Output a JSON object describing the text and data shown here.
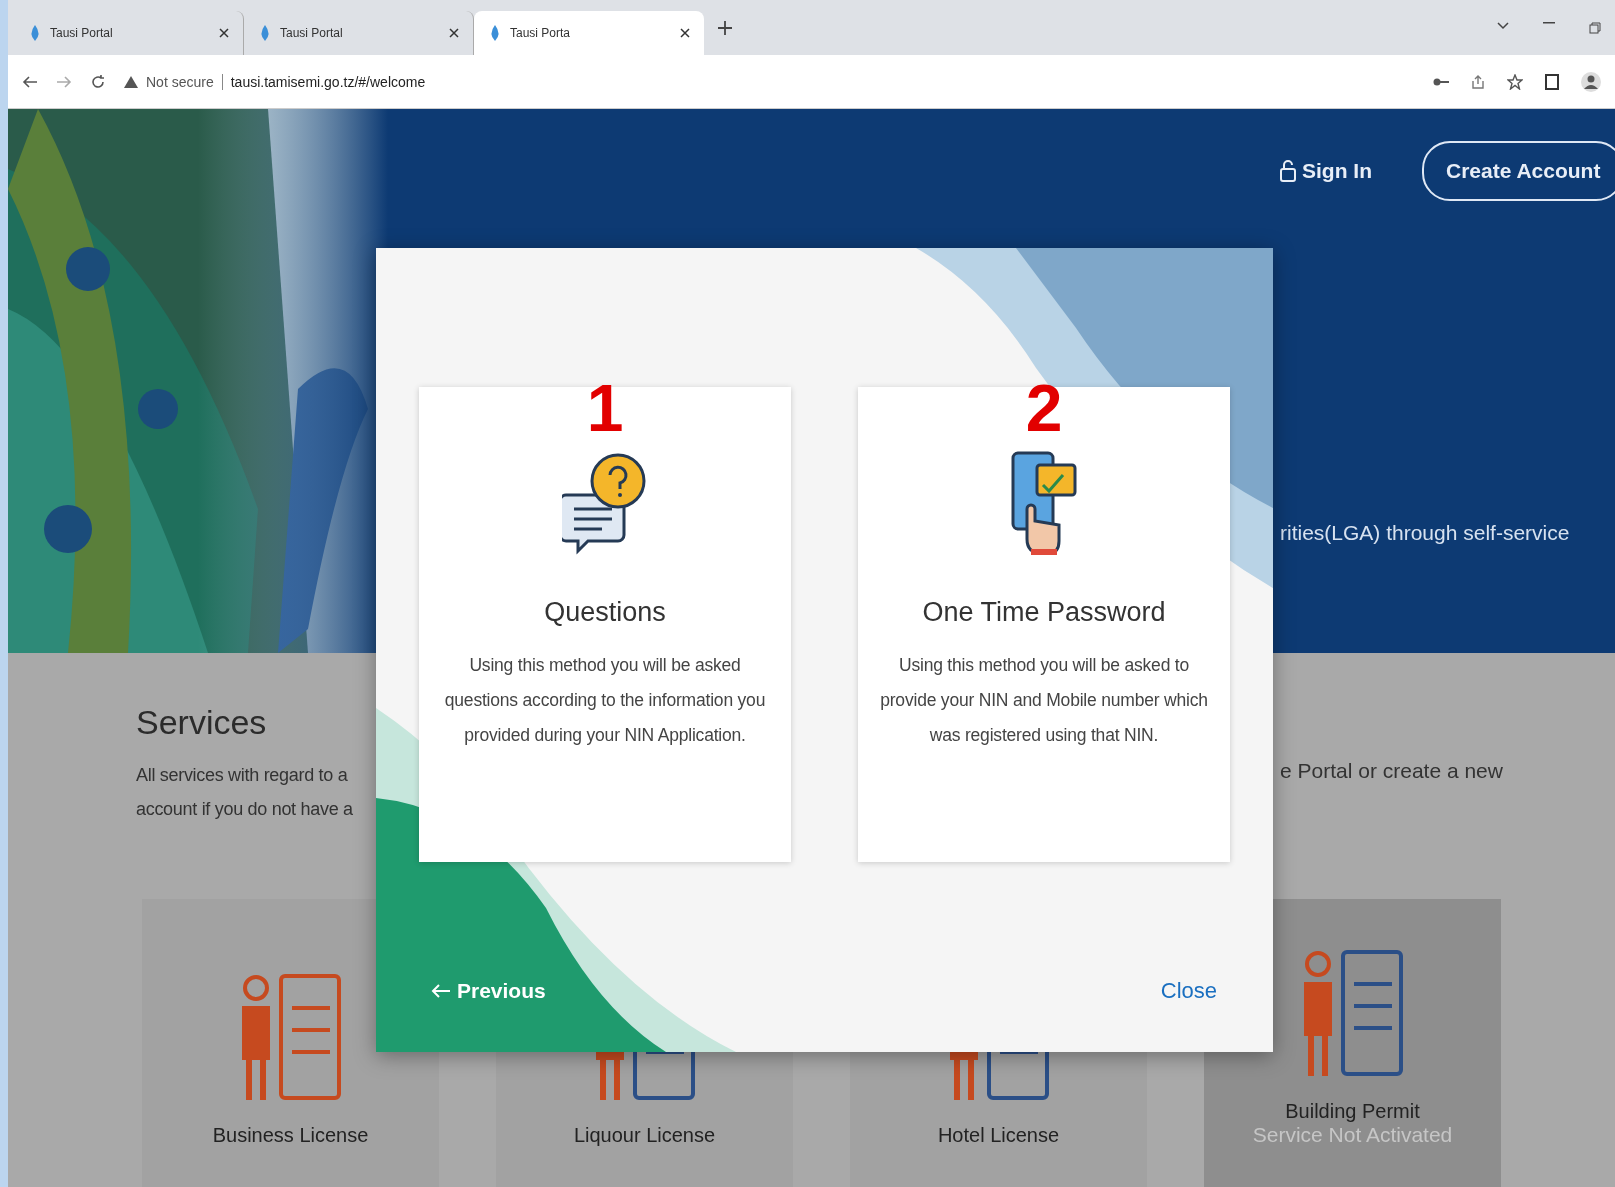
{
  "browser": {
    "tabs": [
      {
        "title": "Tausi Portal",
        "selected": false
      },
      {
        "title": "Tausi Portal",
        "selected": false
      },
      {
        "title": "Tausi Porta",
        "selected": true
      }
    ],
    "security": "Not secure",
    "url": "tausi.tamisemi.go.tz/#/welcome"
  },
  "header": {
    "sign_in": "Sign In",
    "create_account": "Create Account",
    "tagline_fragment": "rities(LGA) through self-service"
  },
  "services": {
    "title": "Services",
    "text_fragments": [
      "All services with regard to a",
      "account if you do not have a"
    ],
    "right_fragment": "e Portal or create a new",
    "cards": [
      {
        "label": "Business License",
        "activated": true
      },
      {
        "label": "Liquour License",
        "activated": true
      },
      {
        "label": "Hotel License",
        "activated": true
      },
      {
        "label": "Building Permit",
        "activated": false,
        "status": "Service Not Activated"
      }
    ]
  },
  "modal": {
    "options": [
      {
        "number": "1",
        "kind": "questions",
        "title": "Questions",
        "text": "Using this method you will be asked questions according to the information you provided during your NIN Application."
      },
      {
        "number": "2",
        "kind": "otp",
        "title": "One Time Password",
        "text": "Using this method you will be asked to provide your NIN and Mobile number which was registered using that NIN."
      }
    ],
    "previous": "Previous",
    "close": "Close"
  }
}
